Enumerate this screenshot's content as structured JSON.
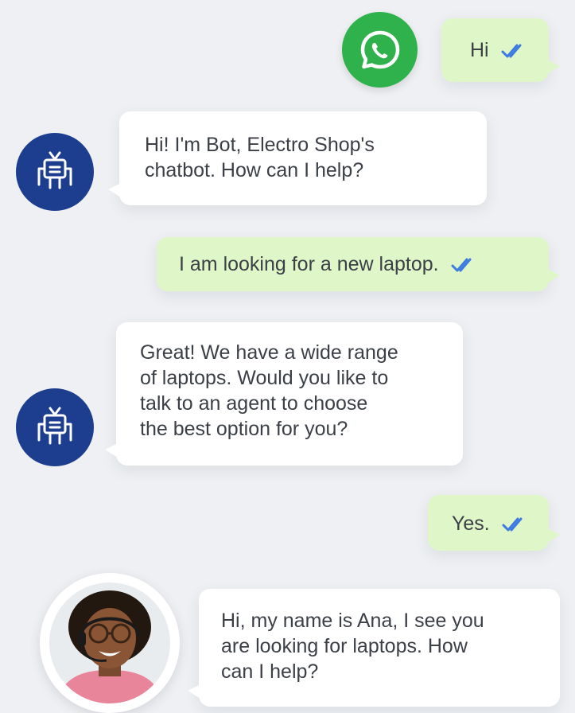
{
  "channel": {
    "icon": "whatsapp-icon"
  },
  "colors": {
    "outgoing_bubble": "#dff7c8",
    "incoming_bubble": "#ffffff",
    "bot_avatar": "#1d3d8f",
    "whatsapp_green": "#2fb24b",
    "read_ticks": "#3d7be0",
    "background": "#eef0f3"
  },
  "messages": [
    {
      "sender": "user",
      "text": "Hi",
      "status": "read"
    },
    {
      "sender": "bot",
      "text": "Hi! I'm Bot, Electro Shop's\nchatbot. How can I help?",
      "avatar_icon": "robot-icon"
    },
    {
      "sender": "user",
      "text": "I am looking for a new laptop.",
      "status": "read"
    },
    {
      "sender": "bot",
      "text": "Great! We have a wide range\nof laptops. Would you like to\ntalk to an agent to choose\nthe best option for you?",
      "avatar_icon": "robot-icon"
    },
    {
      "sender": "user",
      "text": "Yes.",
      "status": "read"
    },
    {
      "sender": "agent",
      "text": "Hi, my name is Ana, I see you\nare looking for laptops. How\ncan I help?",
      "avatar_icon": "agent-photo"
    }
  ]
}
